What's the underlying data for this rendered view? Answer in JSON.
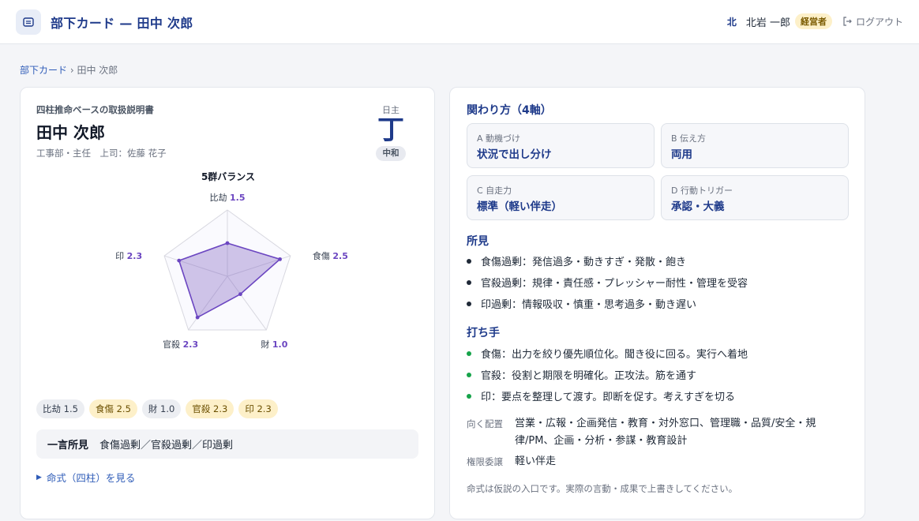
{
  "header": {
    "title": "部下カード — 田中 次郎",
    "user_initial": "北",
    "user_name": "北岩 一郎",
    "role_badge": "経営者",
    "logout_label": "ログアウト"
  },
  "breadcrumb": {
    "parent": "部下カード",
    "separator": "›",
    "current": "田中 次郎"
  },
  "profile": {
    "kicker": "四柱推命ベースの取扱説明書",
    "name": "田中 次郎",
    "meta": "工事部・主任　上司：佐藤 花子",
    "day_master_label": "日主",
    "day_master": "丁",
    "strength": "中和"
  },
  "chart_data": {
    "type": "radar",
    "title": "5群バランス",
    "axes": [
      "比劫",
      "食傷",
      "財",
      "官殺",
      "印"
    ],
    "values": [
      1.5,
      2.5,
      1.0,
      2.3,
      2.3
    ],
    "value_labels": [
      "1.5",
      "2.5",
      "1.0",
      "2.3",
      "2.3"
    ],
    "range": [
      0,
      3
    ],
    "grid_levels": 3,
    "colors": {
      "fill": "#7c5cbf",
      "stroke": "#6b46c1",
      "grid": "#d8d8e0",
      "label_value": "#6b46c1"
    }
  },
  "chips": [
    {
      "label": "比劫 1.5",
      "tone": "neutral"
    },
    {
      "label": "食傷 2.5",
      "tone": "high"
    },
    {
      "label": "財 1.0",
      "tone": "neutral"
    },
    {
      "label": "官殺 2.3",
      "tone": "high"
    },
    {
      "label": "印 2.3",
      "tone": "high"
    }
  ],
  "summary": {
    "label": "一言所見",
    "text": "食傷過剰／官殺過剰／印過剰"
  },
  "details_toggle": "命式（四柱）を見る",
  "relations": {
    "title": "関わり方（4軸）",
    "axes": [
      {
        "label": "A 動機づけ",
        "value": "状況で出し分け"
      },
      {
        "label": "B 伝え方",
        "value": "両用"
      },
      {
        "label": "C 自走力",
        "value": "標準（軽い伴走）"
      },
      {
        "label": "D 行動トリガー",
        "value": "承認・大義"
      }
    ]
  },
  "findings": {
    "title": "所見",
    "items": [
      "食傷過剰：発信過多・動きすぎ・発散・飽き",
      "官殺過剰：規律・責任感・プレッシャー耐性・管理を受容",
      "印過剰：情報吸収・慎重・思考過多・動き遅い"
    ]
  },
  "actions": {
    "title": "打ち手",
    "items": [
      "食傷：出力を絞り優先順位化。聞き役に回る。実行へ着地",
      "官殺：役割と期限を明確化。正攻法。筋を通す",
      "印：要点を整理して渡す。即断を促す。考えすぎを切る"
    ]
  },
  "placement": {
    "label": "向く配置",
    "value": "営業・広報・企画発信・教育・対外窓口、管理職・品質/安全・規律/PM、企画・分析・参謀・教育設計"
  },
  "delegation": {
    "label": "権限委譲",
    "value": "軽い伴走"
  },
  "footnote": "命式は仮説の入口です。実際の言動・成果で上書きしてください。"
}
